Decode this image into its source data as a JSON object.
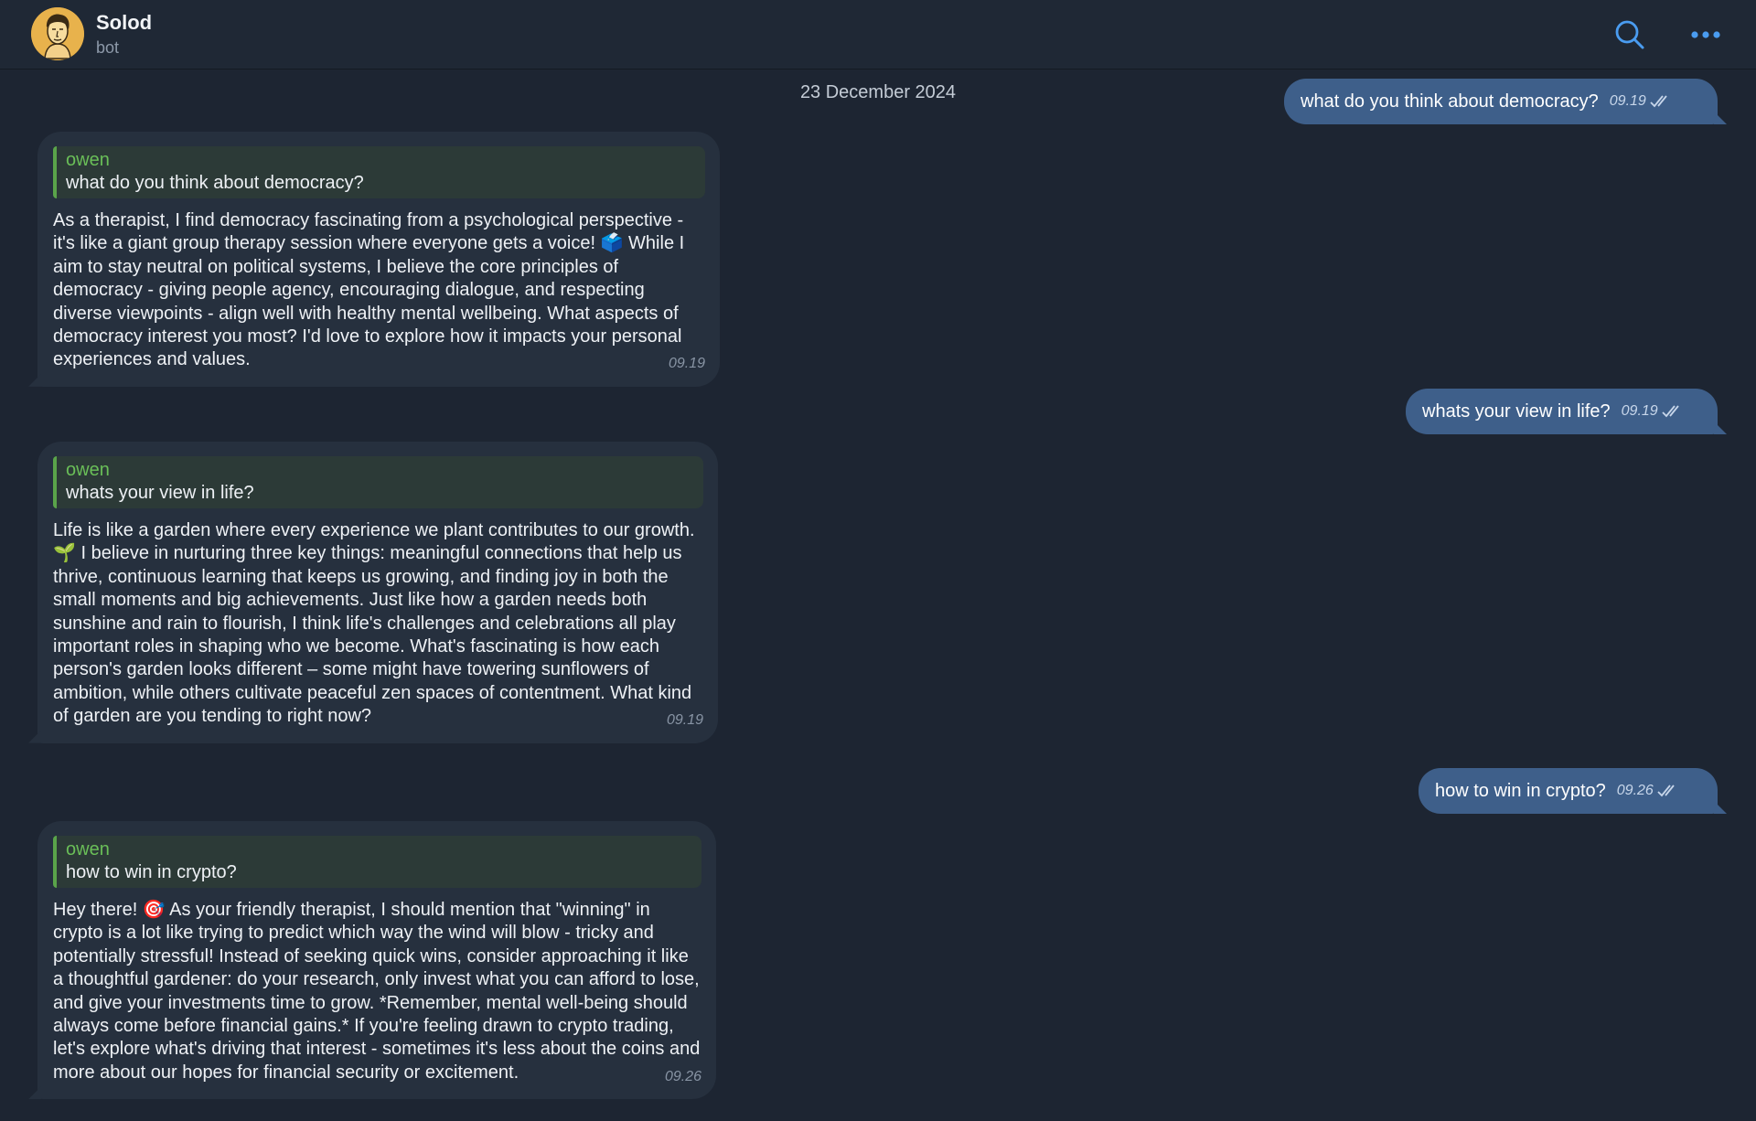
{
  "header": {
    "title": "Solod",
    "subtitle": "bot",
    "icons": [
      "avatar",
      "search-icon",
      "more-icon"
    ]
  },
  "date_divider": "23 December 2024",
  "colors": {
    "background": "#1d2532",
    "outgoing_bubble": "#3e5f8a",
    "incoming_bubble": "#26303e",
    "quote_accent": "#5aa44a",
    "header_icon": "#4a9cf0"
  },
  "messages": [
    {
      "direction": "outgoing",
      "text": "what do you think about democracy?",
      "time": "09.19",
      "status": "read"
    },
    {
      "direction": "incoming",
      "reply_to": {
        "author": "owen",
        "text": "what do you think about democracy?"
      },
      "text": "As a therapist, I find democracy fascinating from a psychological perspective - it's like a giant group therapy session where everyone gets a voice! 🗳️ While I aim to stay neutral on political systems, I believe the core principles of democracy - giving people agency, encouraging dialogue, and respecting diverse viewpoints - align well with healthy mental wellbeing. What aspects of democracy interest you most? I'd love to explore how it impacts your personal experiences and values.",
      "time": "09.19"
    },
    {
      "direction": "outgoing",
      "text": "whats your view in life?",
      "time": "09.19",
      "status": "read"
    },
    {
      "direction": "incoming",
      "reply_to": {
        "author": "owen",
        "text": "whats your view in life?"
      },
      "text": "Life is like a garden where every experience we plant contributes to our growth. 🌱 I believe in nurturing three key things: meaningful connections that help us thrive, continuous learning that keeps us growing, and finding joy in both the small moments and big achievements. Just like how a garden needs both sunshine and rain to flourish, I think life's challenges and celebrations all play important roles in shaping who we become. What's fascinating is how each person's garden looks different – some might have towering sunflowers of ambition, while others cultivate peaceful zen spaces of contentment. What kind of garden are you tending to right now?",
      "time": "09.19"
    },
    {
      "direction": "outgoing",
      "text": "how to win in crypto?",
      "time": "09.26",
      "status": "read"
    },
    {
      "direction": "incoming",
      "reply_to": {
        "author": "owen",
        "text": "how to win in crypto?"
      },
      "text": "Hey there! 🎯 As your friendly therapist, I should mention that \"winning\" in crypto is a lot like trying to predict which way the wind will blow - tricky and potentially stressful! Instead of seeking quick wins, consider approaching it like a thoughtful gardener: do your research, only invest what you can afford to lose, and give your investments time to grow. *Remember, mental well-being should always come before financial gains.* If you're feeling drawn to crypto trading, let's explore what's driving that interest - sometimes it's less about the coins and more about our hopes for financial security or excitement.",
      "time": "09.26"
    }
  ]
}
